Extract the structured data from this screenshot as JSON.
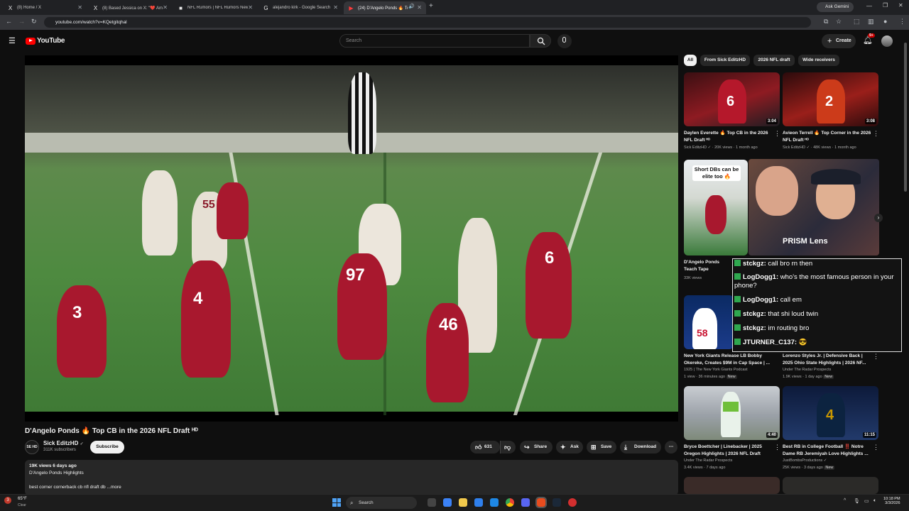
{
  "browser": {
    "tabs": [
      {
        "label": "(8) Home / X",
        "favicon": "X"
      },
      {
        "label": "(8) Based Jessica on X: \"❤️ Am",
        "favicon": "X"
      },
      {
        "label": "NFL Rumors | NFL Rumors New",
        "favicon": "■"
      },
      {
        "label": "alejandro kirk - Google Search",
        "favicon": "G"
      },
      {
        "label": "(24) D'Angelo Ponds 🔥 To",
        "favicon": "▶"
      }
    ],
    "new_tab": "+",
    "url": "youtube.com/watch?v=KQetgitqhal",
    "ask_gemini": "Ask Gemini"
  },
  "youtube": {
    "logo_text": "YouTube",
    "search_placeholder": "Search",
    "create_label": "Create",
    "notif_count": "9+"
  },
  "filters": [
    "All",
    "From Sick EditzHD",
    "2026 NFL draft",
    "Wide receivers"
  ],
  "video": {
    "title": "D'Angelo Ponds 🔥 Top CB in the 2026 NFL Draft ᴴᴰ",
    "channel": "Sick EditzHD",
    "channel_avatar_text": "SE HD",
    "subscribers": "311K subscribers",
    "subscribe_label": "Subscribe",
    "likes": "631",
    "share_label": "Share",
    "ask_label": "Ask",
    "save_label": "Save",
    "download_label": "Download",
    "views_date": "19K views  6 days ago",
    "desc_line1": "D'Angelo Ponds Highlights",
    "desc_line2": "best corner cornerback cb nfl draft db ...more",
    "jersey_numbers": [
      "97",
      "6",
      "46",
      "4",
      "3",
      "55"
    ]
  },
  "stream_overlay": {
    "short_dbs_text": "Short DBs can be elite too 🔥",
    "prism_label": "PRISM Lens",
    "chat": [
      {
        "user": "stckgz:",
        "msg": "call bro rn then"
      },
      {
        "user": "LogDogg1:",
        "msg": "who's the most famous person in your phone?"
      },
      {
        "user": "LogDogg1:",
        "msg": "call em"
      },
      {
        "user": "stckgz:",
        "msg": "that shi loud twin"
      },
      {
        "user": "stckgz:",
        "msg": "im routing bro"
      },
      {
        "user": "JTURNER_C137:",
        "msg": "😎"
      }
    ]
  },
  "recommendations": [
    {
      "title": "Daylen Everette 🔥 Top CB in the 2026 NFL Draft ᴴᴰ",
      "channel": "Sick EditzHD ✓ · 20K views · 1 month ago",
      "duration": "3:04"
    },
    {
      "title": "Avieon Terrell 🔥 Top Corner in the 2026 NFL Draft ᴴᴰ",
      "channel": "Sick EditzHD ✓ · 48K views · 1 month ago",
      "duration": "3:08"
    },
    {
      "title": "D'Angelo Ponds Teach Tape",
      "channel": "33K views",
      "duration": ""
    },
    {
      "title": "New York Giants Release LB Bobby Okereke, Creates $9M in Cap Space | ...",
      "channel": "1925 | The New York Giants Podcast",
      "meta": "1 view · 36 minutes ago",
      "badge": "New",
      "duration": ""
    },
    {
      "title": "Lorenzo Styles Jr. | Defensive Back | 2025 Ohio State Highlights | 2026 NF...",
      "channel": "Under The Radar Prospects",
      "meta": "1.9K views · 1 day ago",
      "badge": "New",
      "duration": ""
    },
    {
      "title": "Bryce Boettcher | Linebacker | 2025 Oregon Highlights | 2026 NFL Draft",
      "channel": "Under The Radar Prospects",
      "meta": "3.4K views · 7 days ago",
      "duration": "4:40"
    },
    {
      "title": "Best RB in College Football ‼️ Notre Dame RB Jeremiyah Love Highlights ...",
      "channel": "JustBombsProductions ✓",
      "meta": "25K views · 3 days ago",
      "badge": "New",
      "duration": "11:15"
    }
  ],
  "taskbar": {
    "weather_temp": "65°F",
    "weather_desc": "Clear",
    "search_label": "Search",
    "time": "10:18 PM",
    "date": "3/3/2026"
  },
  "colors": {
    "bg": "#0f0f0f",
    "accent_red": "#ff0000",
    "chip_bg": "#272727",
    "jersey_red": "#a8182e"
  }
}
